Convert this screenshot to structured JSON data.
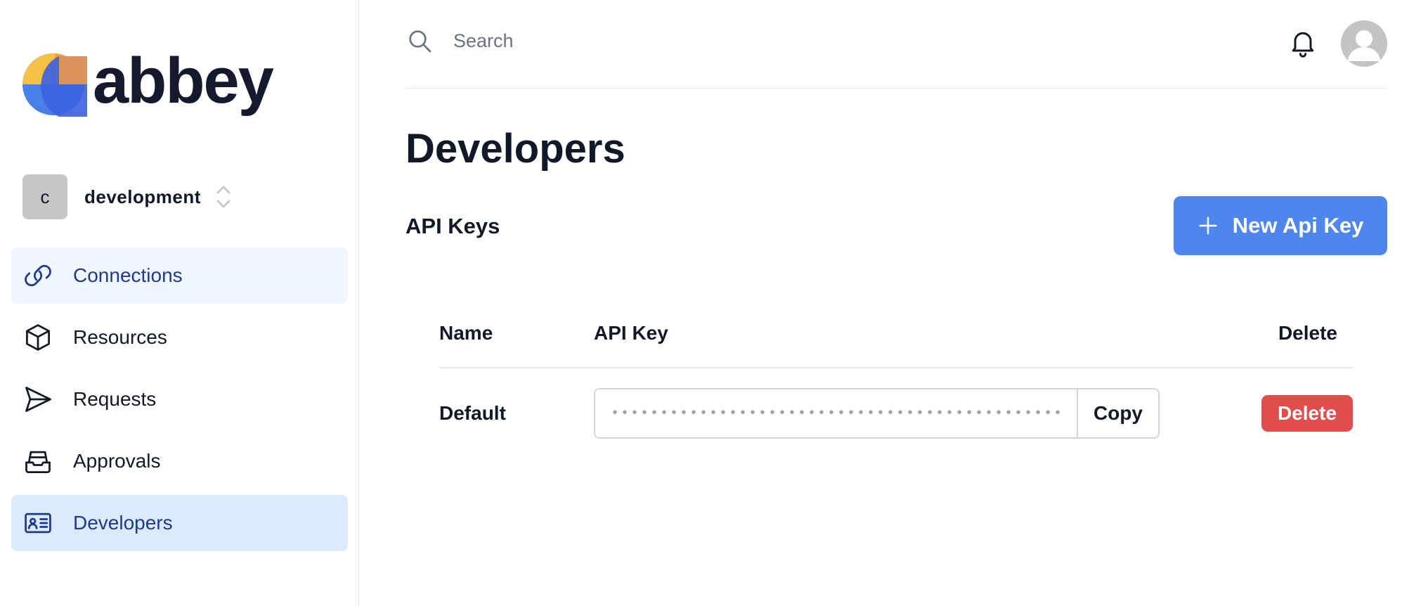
{
  "sidebar": {
    "logo_text": "abbey",
    "environment": {
      "initial": "c",
      "name": "development"
    },
    "nav": [
      {
        "label": "Connections",
        "icon": "link-icon"
      },
      {
        "label": "Resources",
        "icon": "cube-icon"
      },
      {
        "label": "Requests",
        "icon": "paper-plane-icon"
      },
      {
        "label": "Approvals",
        "icon": "inbox-stack-icon"
      },
      {
        "label": "Developers",
        "icon": "id-card-icon"
      }
    ]
  },
  "header": {
    "search_placeholder": "Search",
    "icons": [
      "search-icon",
      "bell-icon",
      "user-avatar-icon"
    ]
  },
  "main": {
    "title": "Developers",
    "section_title": "API Keys",
    "new_key_label": "New Api Key",
    "table": {
      "columns": [
        "Name",
        "API Key",
        "Delete"
      ],
      "rows": [
        {
          "name": "Default",
          "key_masked": "••••••••••••••••••••••••••••••••••••••••••••••••••",
          "copy_label": "Copy",
          "delete_label": "Delete"
        }
      ]
    }
  },
  "colors": {
    "primary": "#4f86ed",
    "danger": "#e04d4d",
    "nav_active_bg": "#dbeafe",
    "nav_soft_bg": "#eff6ff",
    "nav_active_text": "#1e3a8a",
    "logo_yellow": "#f6c244",
    "logo_orange": "#f39a45",
    "logo_blue": "#3d63e0",
    "logo_text": "#14192e"
  }
}
